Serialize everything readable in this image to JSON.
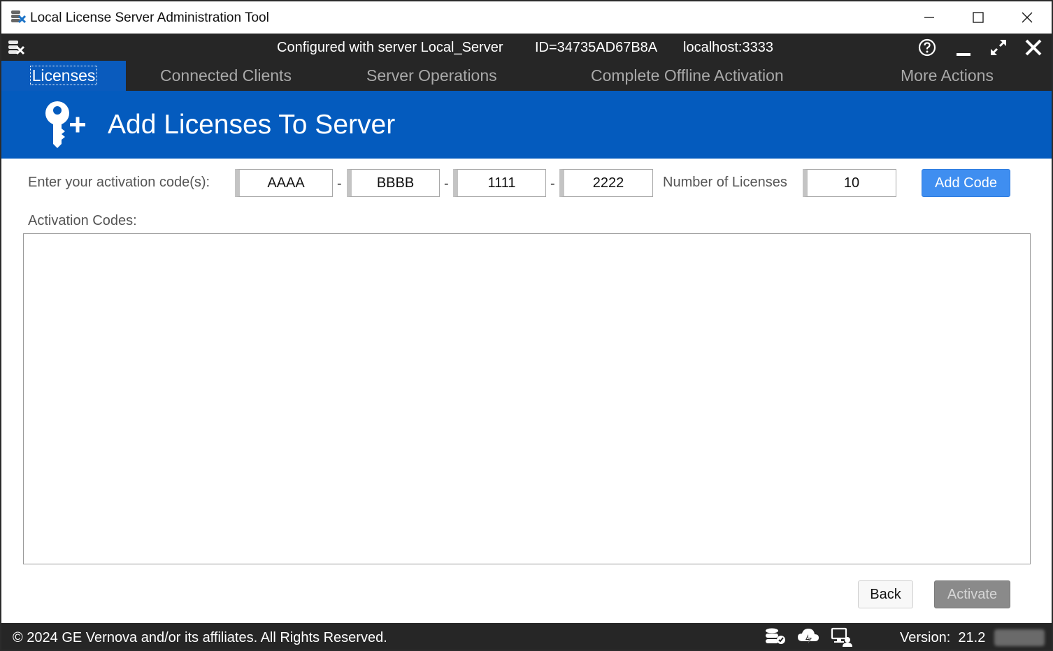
{
  "window": {
    "title": "Local License Server Administration Tool",
    "app_icon": "license-server-tool-icon",
    "controls": [
      "minimize-icon",
      "maximize-icon",
      "close-icon"
    ]
  },
  "header": {
    "server_label": "Configured with server Local_Server",
    "server_id": "ID=34735AD67B8A",
    "host": "localhost:3333",
    "icons": [
      "help-icon",
      "minimize-icon",
      "expand-icon",
      "close-icon"
    ]
  },
  "nav": {
    "tabs": [
      {
        "label": "Licenses",
        "active": true
      },
      {
        "label": "Connected Clients",
        "active": false
      },
      {
        "label": "Server Operations",
        "active": false
      },
      {
        "label": "Complete Offline Activation",
        "active": false
      },
      {
        "label": "More Actions",
        "active": false
      }
    ]
  },
  "banner": {
    "title": "Add Licenses To Server",
    "icon": "key-add-icon"
  },
  "form": {
    "enter_label": "Enter your activation code(s):",
    "code_segments": [
      "AAAA",
      "BBBB",
      "1111",
      "2222"
    ],
    "separator": "-",
    "num_licenses_label": "Number of Licenses",
    "num_licenses_value": "10",
    "add_button": "Add Code",
    "codes_label": "Activation Codes:",
    "codes_list": []
  },
  "actions": {
    "back": "Back",
    "activate": "Activate",
    "activate_enabled": false
  },
  "footer": {
    "copyright": "© 2024 GE Vernova and/or its affiliates.  All Rights Reserved.",
    "icons": [
      "server-database-icon",
      "cloud-sync-icon",
      "client-computer-icon"
    ],
    "version_label": "Version:",
    "version_value": "21.2"
  },
  "colors": {
    "accent": "#045bbe",
    "header_bg": "#262626",
    "add_button": "#3f8ef0"
  }
}
